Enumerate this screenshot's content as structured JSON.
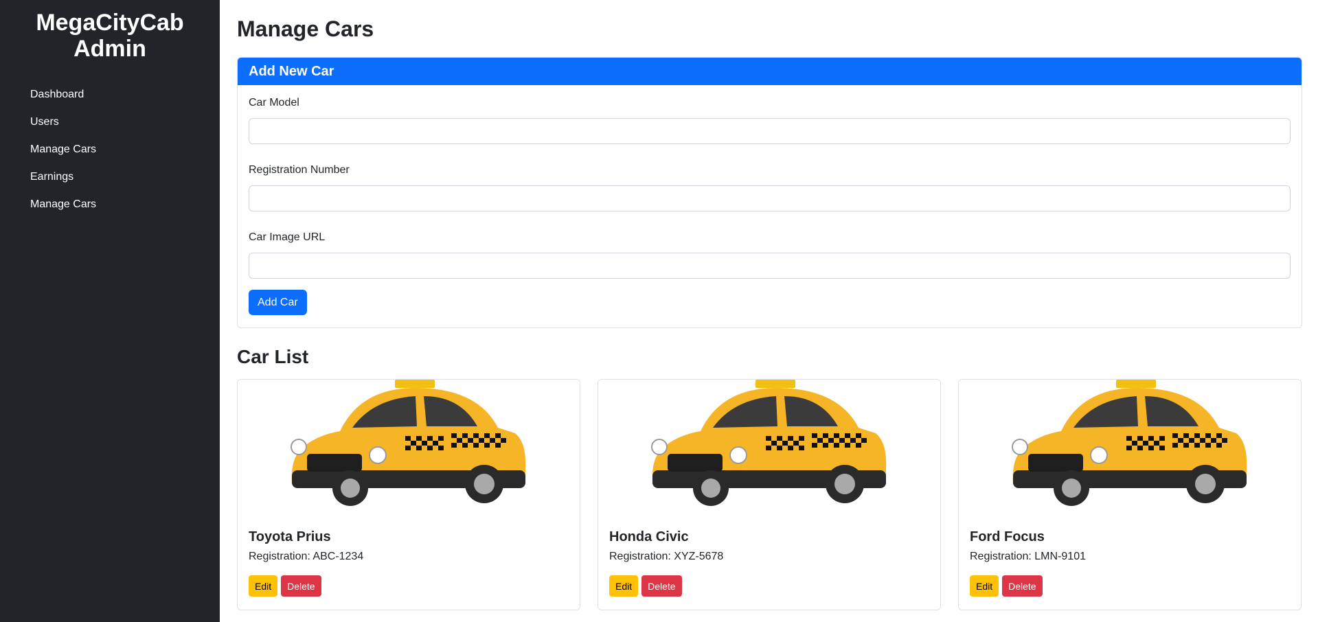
{
  "sidebar": {
    "brand_line1": "MegaCityCab",
    "brand_line2": "Admin",
    "items": [
      {
        "label": "Dashboard"
      },
      {
        "label": "Users"
      },
      {
        "label": "Manage Cars"
      },
      {
        "label": "Earnings"
      },
      {
        "label": "Manage Cars"
      }
    ]
  },
  "main": {
    "title": "Manage Cars",
    "form": {
      "header": "Add New Car",
      "car_model_label": "Car Model",
      "car_model_value": "",
      "registration_label": "Registration Number",
      "registration_value": "",
      "image_url_label": "Car Image URL",
      "image_url_value": "",
      "submit_label": "Add Car"
    },
    "car_list": {
      "title": "Car List",
      "registration_prefix": "Registration:",
      "edit_label": "Edit",
      "delete_label": "Delete",
      "cars": [
        {
          "model": "Toyota Prius",
          "registration": "ABC-1234",
          "image_icon": "yellow-taxi-cab"
        },
        {
          "model": "Honda Civic",
          "registration": "XYZ-5678",
          "image_icon": "yellow-taxi-cab"
        },
        {
          "model": "Ford Focus",
          "registration": "LMN-9101",
          "image_icon": "yellow-taxi-cab"
        }
      ]
    }
  },
  "colors": {
    "sidebar_bg": "#212529",
    "primary": "#0d6efd",
    "warning": "#ffc107",
    "danger": "#dc3545",
    "taxi_yellow": "#f6b526"
  }
}
